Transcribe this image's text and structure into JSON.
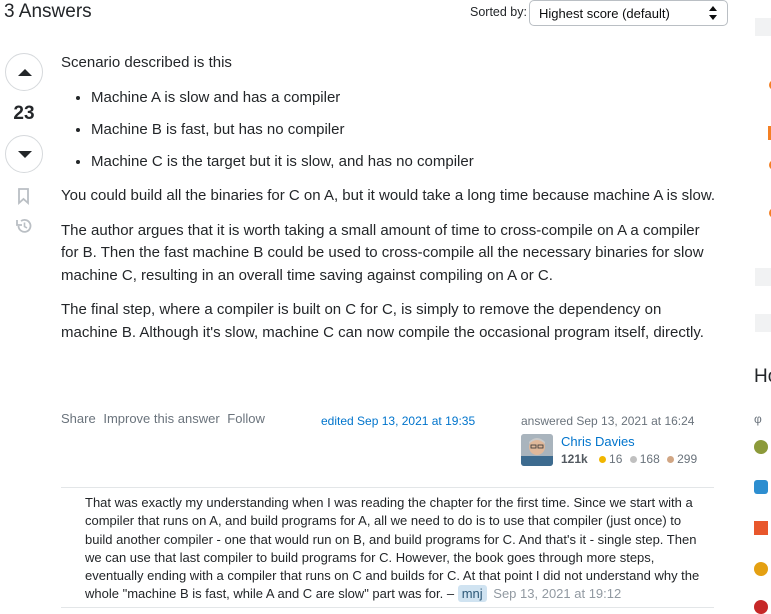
{
  "header": {
    "answers_title": "3 Answers",
    "sort_label": "Sorted by:",
    "sort_value": "Highest score (default)"
  },
  "vote": {
    "score": "23",
    "upvote_icon": "arrow-up-icon",
    "downvote_icon": "arrow-down-icon",
    "bookmark_icon": "bookmark-icon",
    "history_icon": "history-icon"
  },
  "answer": {
    "intro": "Scenario described is this",
    "bullets": [
      "Machine A is slow and has a compiler",
      "Machine B is fast, but has no compiler",
      "Machine C is the target but it is slow, and has no compiler"
    ],
    "paragraphs": [
      "You could build all the binaries for C on A, but it would take a long time because machine A is slow.",
      "The author argues that it is worth taking a small amount of time to cross-compile on A a compiler for B. Then the fast machine B could be used to cross-compile all the necessary binaries for slow machine C, resulting in an overall time saving against compiling on A or C.",
      "The final step, where a compiler is built on C for C, is simply to remove the dependency on machine B. Although it's slow, machine C can now compile the occasional program itself, directly."
    ]
  },
  "post_menu": {
    "share": "Share",
    "improve": "Improve this answer",
    "follow": "Follow"
  },
  "edited": "edited Sep 13, 2021 at 19:35",
  "answered": "answered Sep 13, 2021 at 16:24",
  "user": {
    "name": "Chris Davies",
    "reputation": "121k",
    "gold": "16",
    "silver": "168",
    "bronze": "299",
    "gold_color": "#f1b600",
    "silver_color": "#c0c0c0",
    "bronze_color": "#d1a684"
  },
  "comment": {
    "text": "That was exactly my understanding when I was reading the chapter for the first time. Since we start with a compiler that runs on A, and build programs for A, all we need to do is to use that compiler (just once) to build another compiler - one that would run on B, and build programs for C. And that's it - single step. Then we can use that last compiler to build programs for C. However, the book goes through more steps, eventually ending with a compiler that runs on C and builds for C. At that point I did not understand why the whole \"machine B is fast, while A and C are slow\" part was for. –",
    "author": "mnj",
    "date": "Sep 13, 2021 at 19:12"
  },
  "sidebar": {
    "heading": "Ho"
  },
  "colors": {
    "link": "#0074cc",
    "muted": "#6a737c",
    "text": "#232629"
  }
}
